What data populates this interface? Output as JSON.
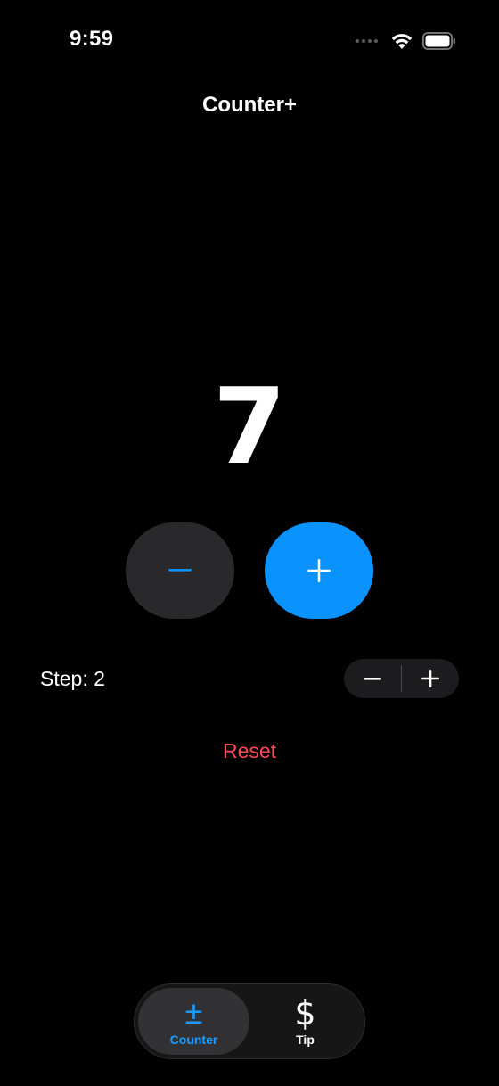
{
  "status_bar": {
    "time": "9:59",
    "signal_icon": "signal-dots-icon",
    "wifi_icon": "wifi-icon",
    "battery_icon": "battery-icon"
  },
  "nav": {
    "title": "Counter+"
  },
  "counter": {
    "value": "7",
    "decrement_icon": "minus-icon",
    "increment_icon": "plus-icon"
  },
  "step": {
    "label": "Step: 2",
    "decrement_icon": "minus-icon",
    "increment_icon": "plus-icon"
  },
  "reset": {
    "label": "Reset"
  },
  "tabs": [
    {
      "label": "Counter",
      "icon_glyph": "±",
      "icon": "plus-minus-icon",
      "active": true
    },
    {
      "label": "Tip",
      "icon_glyph": "$",
      "icon": "dollar-icon",
      "active": false
    }
  ],
  "colors": {
    "accent": "#0a92ff",
    "tab_active": "#1a9cff",
    "destructive": "#ff4a55",
    "background": "#000000"
  }
}
